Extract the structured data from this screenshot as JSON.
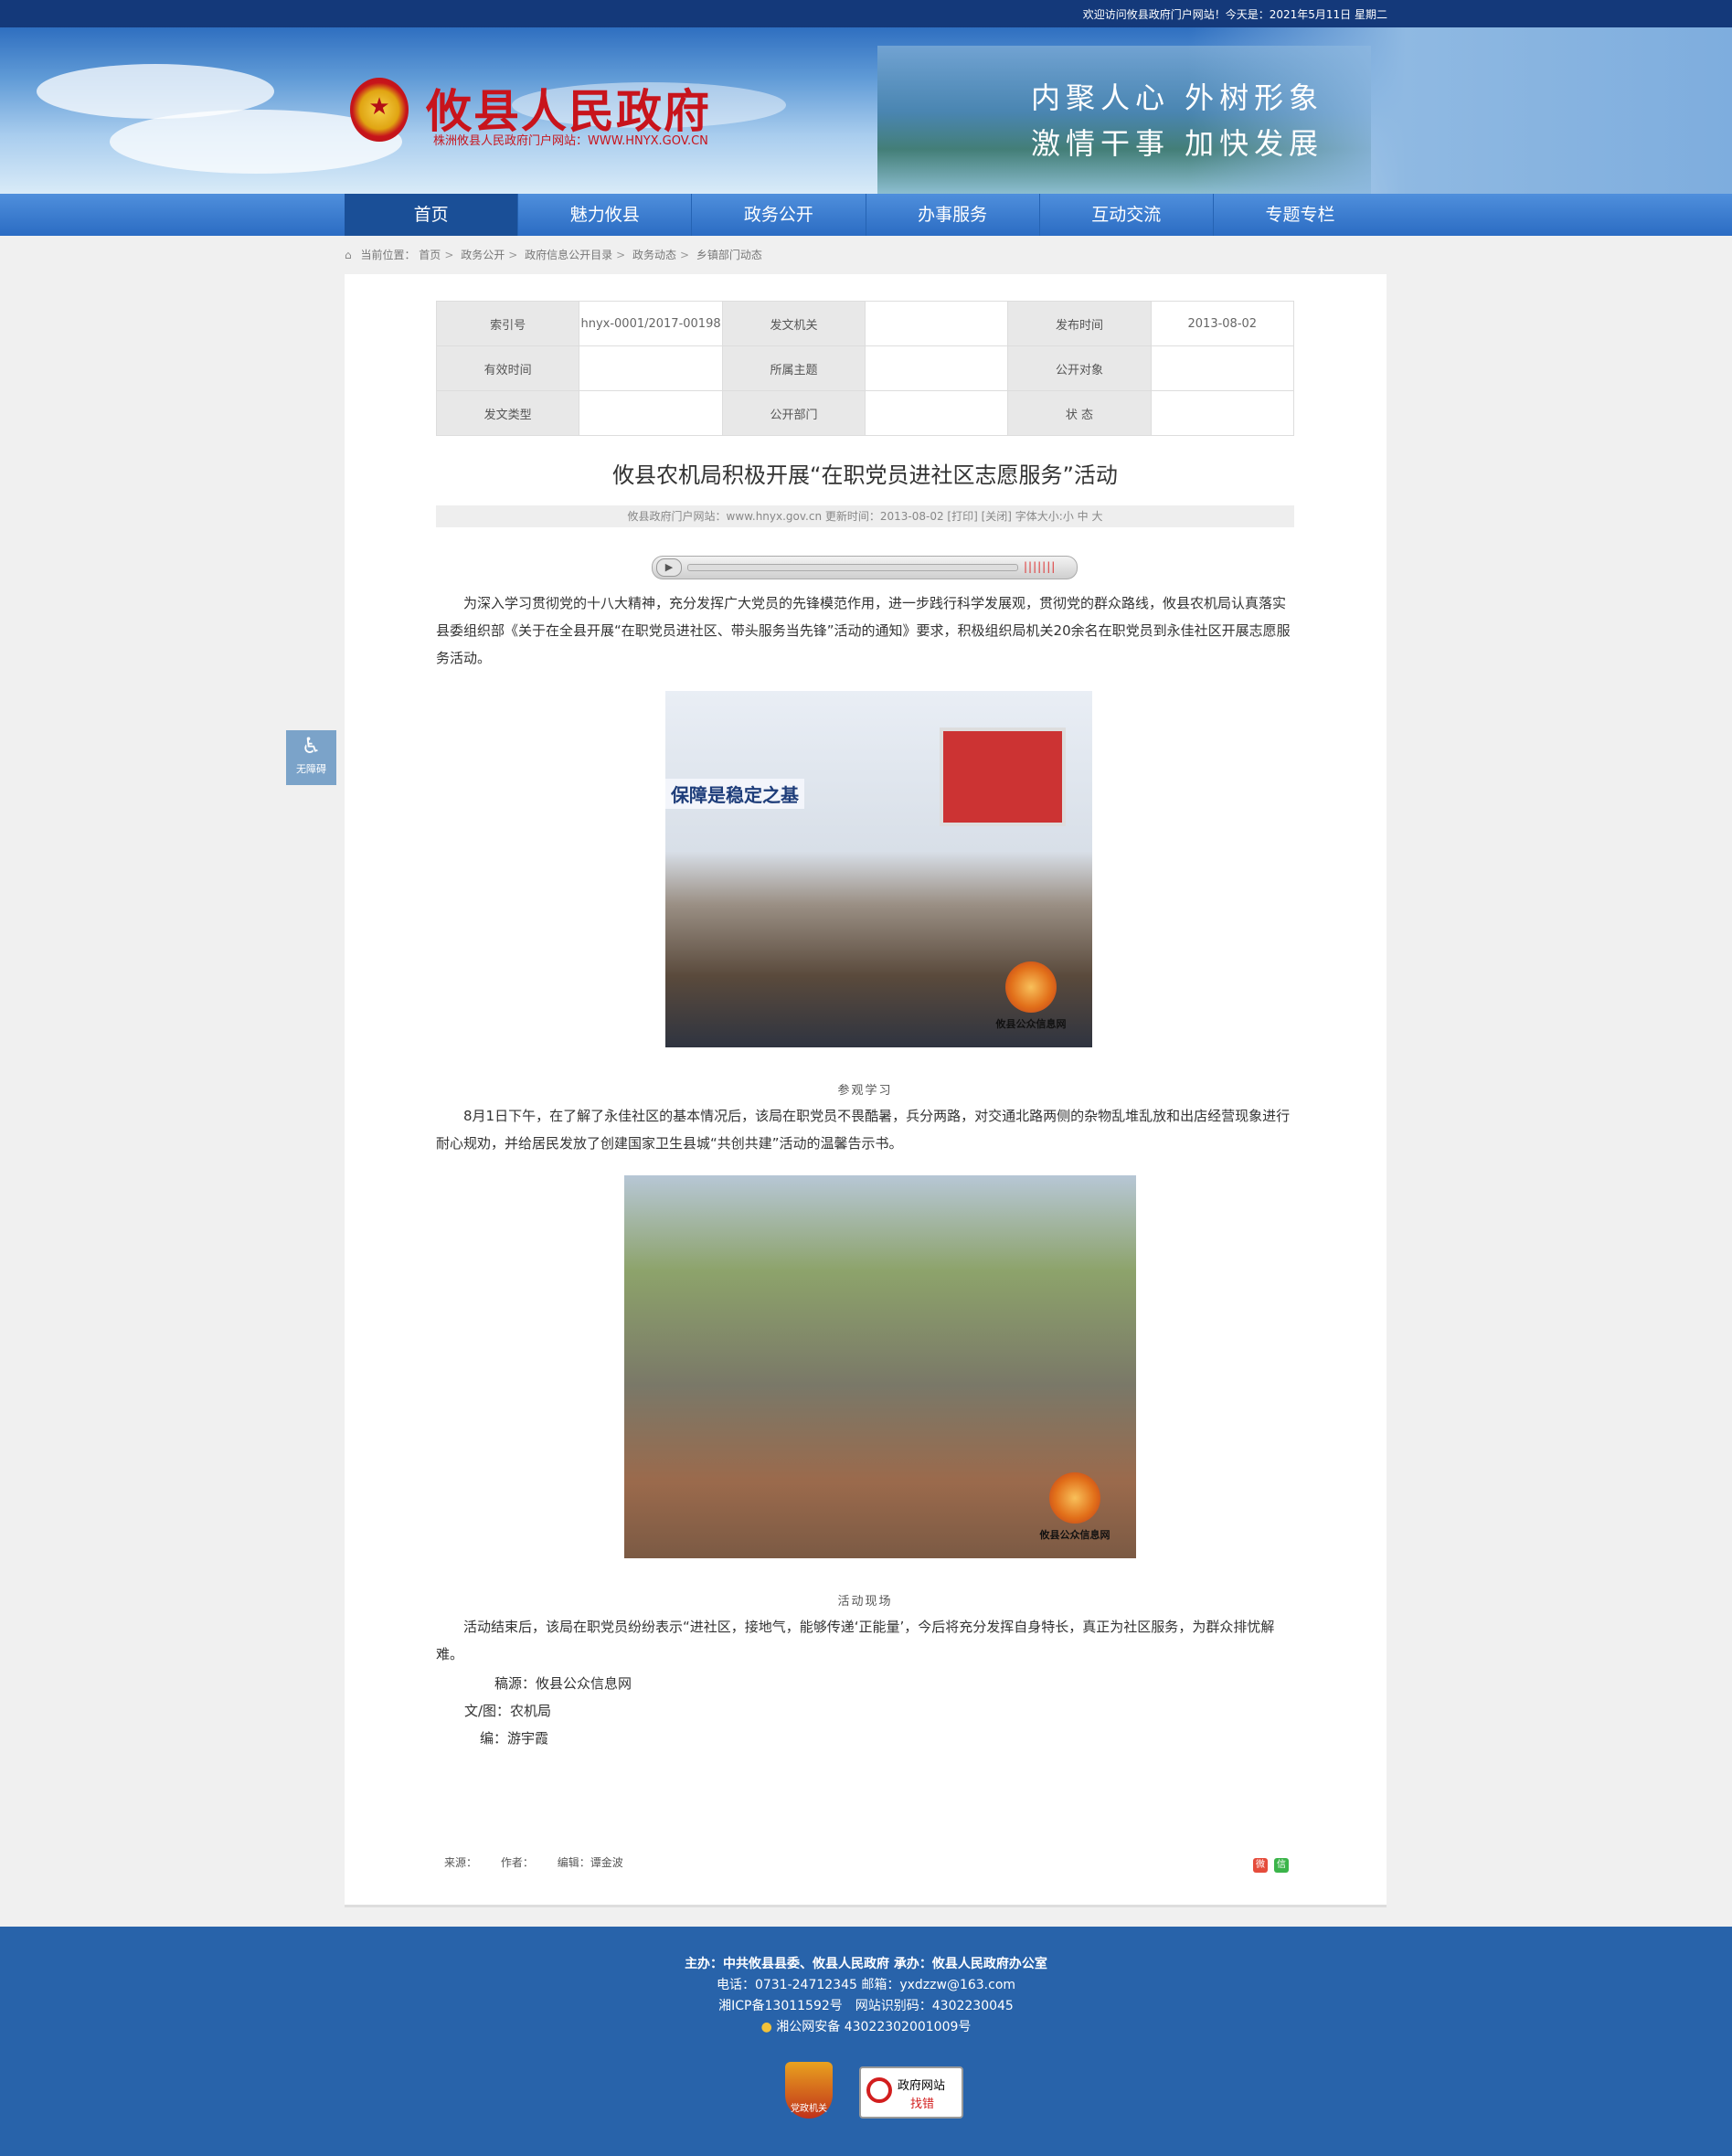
{
  "header": {
    "welcome": "欢迎访问攸县政府门户网站！今天是：2021年5月11日 星期二",
    "site_title": "攸县人民政府",
    "site_subtitle": "株洲攸县人民政府门户网站：WWW.HNYX.GOV.CN",
    "slogan_line1": "内聚人心 外树形象",
    "slogan_line2": "激情干事 加快发展",
    "emblem_icon": "national-emblem-icon"
  },
  "nav": {
    "items": [
      "首页",
      "魅力攸县",
      "政务公开",
      "办事服务",
      "互动交流",
      "专题专栏"
    ],
    "active": "首页"
  },
  "breadcrumb": {
    "label": "当前位置：",
    "items": [
      "首页",
      "政务公开",
      "政府信息公开目录",
      "政务动态",
      "乡镇部门动态"
    ],
    "separator": ">"
  },
  "meta_table": {
    "rows": [
      [
        {
          "k": "索引号",
          "v": "hnyx-0001/2017-00198"
        },
        {
          "k": "发文机关",
          "v": ""
        },
        {
          "k": "发布时间",
          "v": "2013-08-02"
        }
      ],
      [
        {
          "k": "有效时间",
          "v": ""
        },
        {
          "k": "所属主题",
          "v": ""
        },
        {
          "k": "公开对象",
          "v": ""
        }
      ],
      [
        {
          "k": "发文类型",
          "v": ""
        },
        {
          "k": "公开部门",
          "v": ""
        },
        {
          "k": "状 态",
          "v": ""
        }
      ]
    ]
  },
  "article": {
    "title": "攸县农机局积极开展“在职党员进社区志愿服务”活动",
    "info_bar": "攸县政府门户网站：www.hnyx.gov.cn  更新时间：2013-08-02  [打印] [关闭]  字体大小:小 中 大",
    "para1": "为深入学习贯彻党的十八大精神，充分发挥广大党员的先锋模范作用，进一步践行科学发展观，贯彻党的群众路线，攸县农机局认真落实县委组织部《关于在全县开展“在职党员进社区、带头服务当先锋”活动的通知》要求，积极组织局机关20余名在职党员到永佳社区开展志愿服务活动。",
    "photo1_wall_text": "保障是稳定之基",
    "photo_watermark": "攸县公众信息网",
    "caption1": "参观学习",
    "para2": "8月1日下午，在了解了永佳社区的基本情况后，该局在职党员不畏酷暑，兵分两路，对交通北路两侧的杂物乱堆乱放和出店经营现象进行耐心规劝，并给居民发放了创建国家卫生县城“共创共建”活动的温馨告示书。",
    "caption2": "活动现场",
    "para3": "活动结束后，该局在职党员纷纷表示“进社区，接地气，能够传递‘正能量’，今后将充分发挥自身特长，真正为社区服务，为群众排忧解难。",
    "source_line": "稿源：攸县公众信息网",
    "photo_credit": "文/图：农机局",
    "editor_line": "编：游宇霞"
  },
  "article_footer": {
    "source": "来源：",
    "author": "作者：",
    "editor": "编辑：谭金波"
  },
  "share": {
    "weibo_icon": "weibo-share-icon",
    "wechat_icon": "wechat-share-icon"
  },
  "accessibility": {
    "label": "无障碍",
    "icon": "wheelchair-icon"
  },
  "player": {
    "play_icon": "play-icon"
  },
  "footer": {
    "line1": "主办：中共攸县县委、攸县人民政府 承办：攸县人民政府办公室",
    "line2": "电话：0731-24712345 邮箱：yxdzzw@163.com",
    "line3": "湘ICP备13011592号　网站识别码：4302230045",
    "line4": "湘公网安备 43022302001009号",
    "badge1_label": "党政机关",
    "badge2_line1": "政府网站",
    "badge2_line2": "找错"
  }
}
